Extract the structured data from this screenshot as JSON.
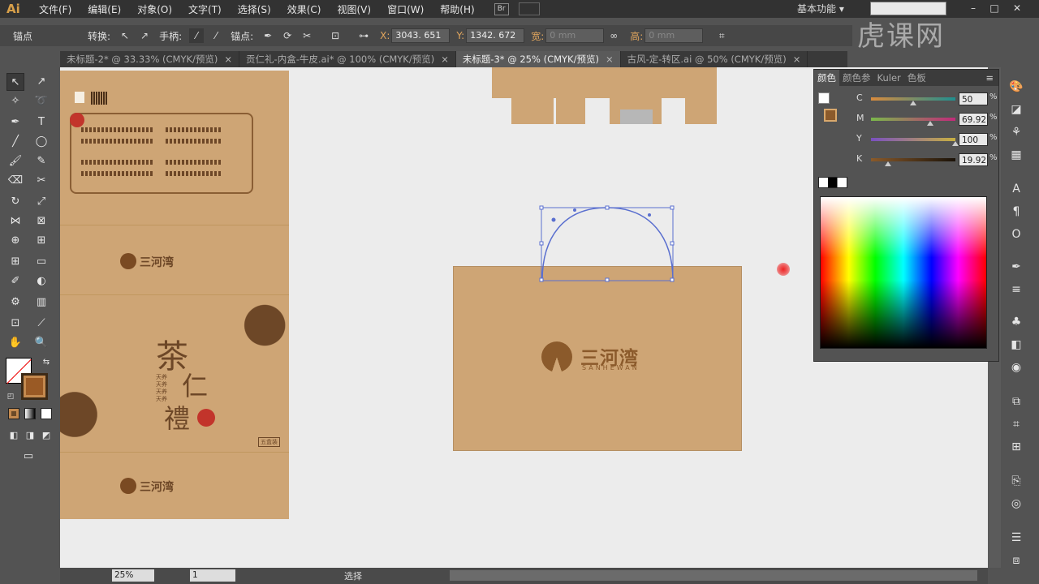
{
  "app": {
    "logo": "Ai",
    "br_badge": "Br",
    "workspace": "基本功能",
    "brand_watermark": "虎课网"
  },
  "menu": [
    "文件(F)",
    "编辑(E)",
    "对象(O)",
    "文字(T)",
    "选择(S)",
    "效果(C)",
    "视图(V)",
    "窗口(W)",
    "帮助(H)"
  ],
  "control": {
    "anchor_label": "锚点",
    "convert_label": "转换:",
    "handle_label": "手柄:",
    "anchor_point_label": "锚点:",
    "x_label": "X:",
    "x_value": "3043. 651",
    "y_label": "Y:",
    "y_value": "1342. 672",
    "w_label": "宽:",
    "w_value": "0 mm",
    "h_label": "高:",
    "h_value": "0 mm"
  },
  "tabs": [
    {
      "label": "未标题-2* @ 33.33% (CMYK/预览)",
      "active": false
    },
    {
      "label": "贡仁礼-内盒-牛皮.ai* @ 100% (CMYK/预览)",
      "active": false
    },
    {
      "label": "未标题-3* @ 25% (CMYK/预览)",
      "active": true
    },
    {
      "label": "古风-定-转区.ai @ 50% (CMYK/预览)",
      "active": false
    }
  ],
  "color_panel": {
    "tabs": [
      "颜色",
      "颜色参",
      "Kuler",
      "色板"
    ],
    "sliders": [
      {
        "label": "C",
        "value": "50",
        "pos": 0.5,
        "from": "#d98b3d",
        "to": "#1f8f8f"
      },
      {
        "label": "M",
        "value": "69.92",
        "pos": 0.6992,
        "from": "#7ab84a",
        "to": "#c22a7a"
      },
      {
        "label": "Y",
        "value": "100",
        "pos": 1.0,
        "from": "#7a50c0",
        "to": "#c8b040"
      },
      {
        "label": "K",
        "value": "19.92",
        "pos": 0.1992,
        "from": "#8a5a2a",
        "to": "#1a1208"
      }
    ],
    "pct": "%"
  },
  "artwork": {
    "brand_cn": "三河湾",
    "brand_en": "SANHEWAN",
    "title_chars": [
      "茶",
      "仁",
      "禮"
    ],
    "bullets": [
      "天养",
      "天养",
      "天养",
      "天养"
    ],
    "tag": "五盒装"
  },
  "status": {
    "zoom": "25%",
    "page": "1",
    "tool": "选择"
  }
}
